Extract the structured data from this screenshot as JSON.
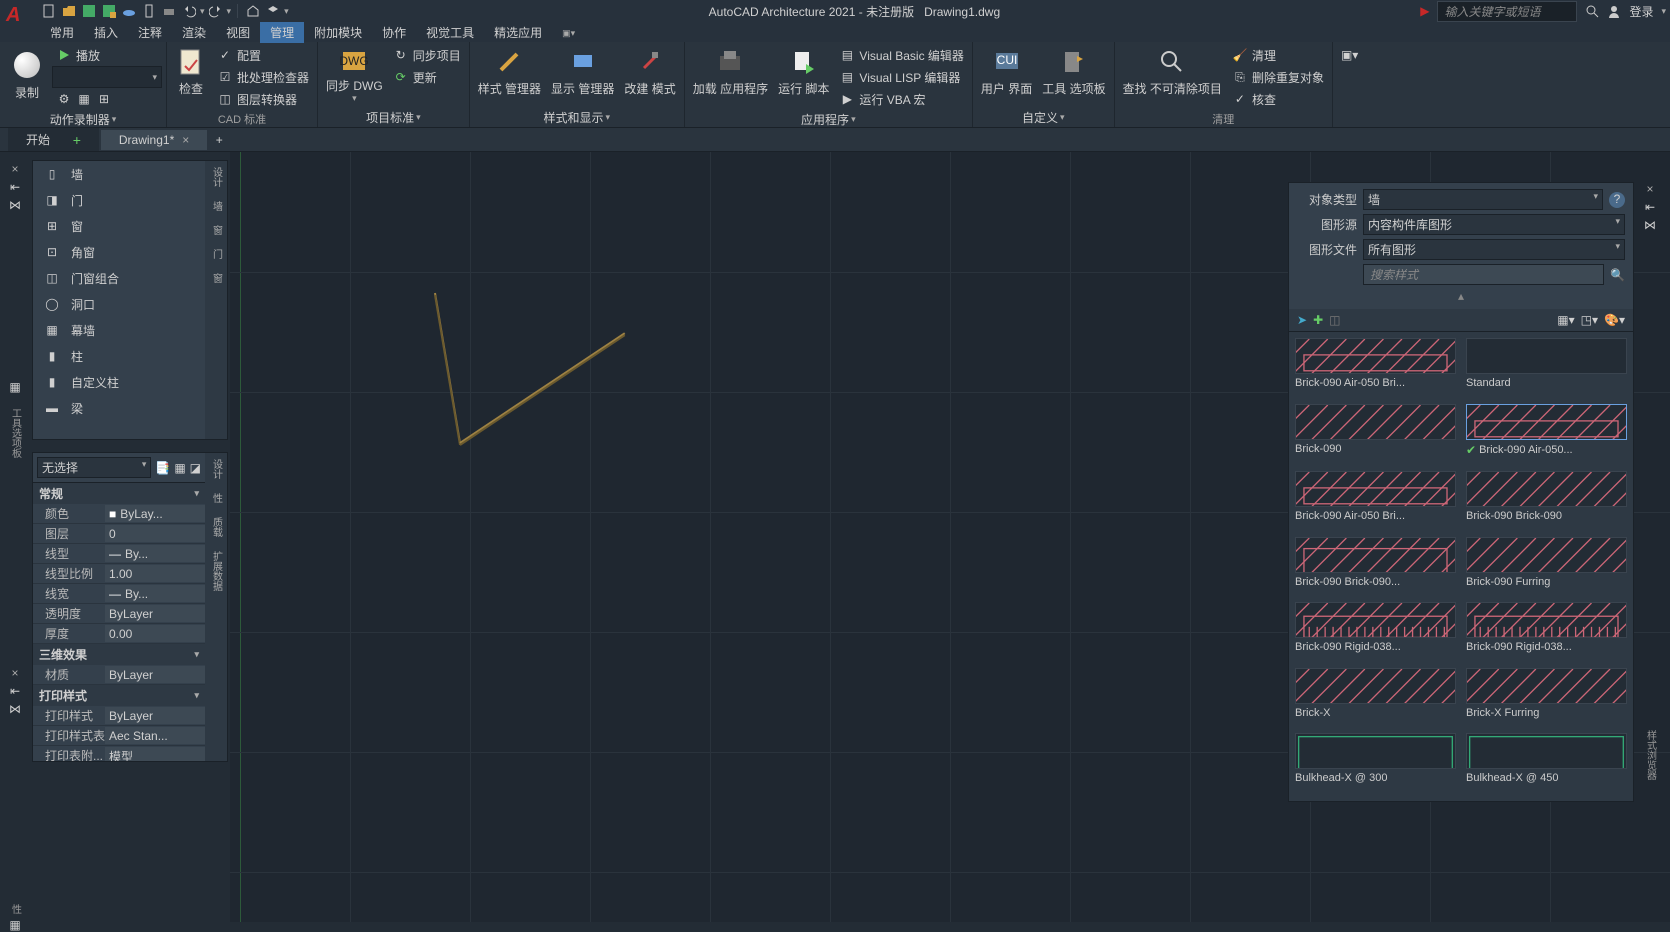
{
  "title": {
    "app": "AutoCAD Architecture 2021 - 未注册版",
    "doc": "Drawing1.dwg"
  },
  "search_placeholder": "输入关键字或短语",
  "login": "登录",
  "menu": [
    "常用",
    "插入",
    "注释",
    "渲染",
    "视图",
    "管理",
    "附加模块",
    "协作",
    "视觉工具",
    "精选应用"
  ],
  "menu_active": 5,
  "ribbon": {
    "rec": {
      "label": "录制",
      "panel": "动作录制器",
      "play": "播放"
    },
    "check": {
      "label": "检查",
      "cfg": "配置",
      "batch": "批处理检查器",
      "layer": "图层转换器",
      "panel": "CAD 标准"
    },
    "proj": {
      "sync_dwg": "同步 DWG",
      "sync_proj": "同步项目",
      "update": "更新",
      "panel": "项目标准"
    },
    "style": {
      "a": "样式 管理器",
      "b": "显示 管理器",
      "c": "改建 模式",
      "panel": "样式和显示"
    },
    "app": {
      "load": "加载 应用程序",
      "run": "运行 脚本",
      "vb": "Visual Basic 编辑器",
      "vl": "Visual LISP 编辑器",
      "vba": "运行 VBA 宏",
      "panel": "应用程序"
    },
    "cust": {
      "ui": "用户 界面",
      "tool": "工具 选项板",
      "panel": "自定义"
    },
    "clean": {
      "find": "查找 不可清除项目",
      "clean": "清理",
      "deldup": "删除重复对象",
      "audit": "核查",
      "panel": "清理"
    }
  },
  "tabs": {
    "start": "开始",
    "doc": "Drawing1*"
  },
  "palette": {
    "items": [
      "墙",
      "门",
      "窗",
      "角窗",
      "门窗组合",
      "洞口",
      "幕墙",
      "柱",
      "自定义柱",
      "梁"
    ],
    "tabs": [
      "设计",
      "墙",
      "窗",
      "门",
      "窗"
    ]
  },
  "props": {
    "nosel": "无选择",
    "groups": {
      "general": "常规",
      "threed": "三维效果",
      "print": "打印样式"
    },
    "rows": {
      "color": {
        "l": "颜色",
        "v": "ByLay..."
      },
      "layer": {
        "l": "图层",
        "v": "0"
      },
      "ltype": {
        "l": "线型",
        "v": "By..."
      },
      "lscale": {
        "l": "线型比例",
        "v": "1.00"
      },
      "lwt": {
        "l": "线宽",
        "v": "By..."
      },
      "trans": {
        "l": "透明度",
        "v": "ByLayer"
      },
      "thick": {
        "l": "厚度",
        "v": "0.00"
      },
      "mat": {
        "l": "材质",
        "v": "ByLayer"
      },
      "pstyle": {
        "l": "打印样式",
        "v": "ByLayer"
      },
      "ptable": {
        "l": "打印样式表",
        "v": "Aec Stan..."
      },
      "pattach": {
        "l": "打印表附...",
        "v": "模型"
      }
    },
    "sidetabs": [
      "设计",
      "性",
      "质载",
      "扩展数据"
    ]
  },
  "right": {
    "objtype": {
      "l": "对象类型",
      "v": "墙"
    },
    "src": {
      "l": "图形源",
      "v": "内容构件库图形"
    },
    "file": {
      "l": "图形文件",
      "v": "所有图形"
    },
    "search": "搜索样式",
    "sidetab": "样式浏览器",
    "items": [
      {
        "n": "Brick-090 Air-050 Bri...",
        "t": "brick"
      },
      {
        "n": "Standard",
        "t": "empty"
      },
      {
        "n": "Brick-090",
        "t": "hatch"
      },
      {
        "n": "Brick-090 Air-050...",
        "t": "brick",
        "sel": true
      },
      {
        "n": "Brick-090 Air-050 Bri...",
        "t": "brick"
      },
      {
        "n": "Brick-090 Brick-090",
        "t": "hatch"
      },
      {
        "n": "Brick-090 Brick-090...",
        "t": "brick2"
      },
      {
        "n": "Brick-090 Furring",
        "t": "hatch"
      },
      {
        "n": "Brick-090 Rigid-038...",
        "t": "rigid"
      },
      {
        "n": "Brick-090 Rigid-038...",
        "t": "rigid"
      },
      {
        "n": "Brick-X",
        "t": "hatch"
      },
      {
        "n": "Brick-X Furring",
        "t": "hatch"
      },
      {
        "n": "Bulkhead-X @ 300",
        "t": "green"
      },
      {
        "n": "Bulkhead-X @ 450",
        "t": "green"
      }
    ]
  }
}
